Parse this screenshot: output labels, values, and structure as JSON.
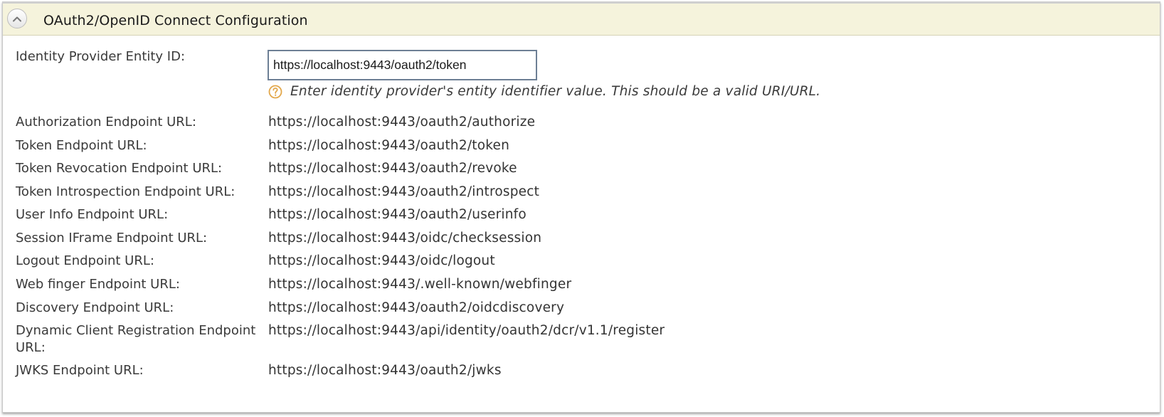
{
  "header": {
    "title": "OAuth2/OpenID Connect Configuration",
    "toggle_icon": "chevron-up-icon"
  },
  "entity_id": {
    "label": "Identity Provider Entity ID:",
    "value": "https://localhost:9443/oauth2/token",
    "help_icon": "question-icon",
    "help_text": "Enter identity provider's entity identifier value. This should be a valid URI/URL."
  },
  "endpoints": [
    {
      "label": "Authorization Endpoint URL:",
      "value": "https://localhost:9443/oauth2/authorize"
    },
    {
      "label": "Token Endpoint URL:",
      "value": "https://localhost:9443/oauth2/token"
    },
    {
      "label": "Token Revocation Endpoint URL:",
      "value": "https://localhost:9443/oauth2/revoke"
    },
    {
      "label": "Token Introspection Endpoint URL:",
      "value": "https://localhost:9443/oauth2/introspect"
    },
    {
      "label": "User Info Endpoint URL:",
      "value": "https://localhost:9443/oauth2/userinfo"
    },
    {
      "label": "Session IFrame Endpoint URL:",
      "value": "https://localhost:9443/oidc/checksession"
    },
    {
      "label": "Logout Endpoint URL:",
      "value": "https://localhost:9443/oidc/logout"
    },
    {
      "label": "Web finger Endpoint URL:",
      "value": "https://localhost:9443/.well-known/webfinger"
    },
    {
      "label": "Discovery Endpoint URL:",
      "value": "https://localhost:9443/oauth2/oidcdiscovery"
    },
    {
      "label": "Dynamic Client Registration Endpoint URL:",
      "value": "https://localhost:9443/api/identity/oauth2/dcr/v1.1/register"
    },
    {
      "label": "JWKS Endpoint URL:",
      "value": "https://localhost:9443/oauth2/jwks"
    }
  ],
  "colors": {
    "header_bg": "#f5f3dc",
    "help_icon": "#e2a74a",
    "input_border": "#6d7f95"
  }
}
